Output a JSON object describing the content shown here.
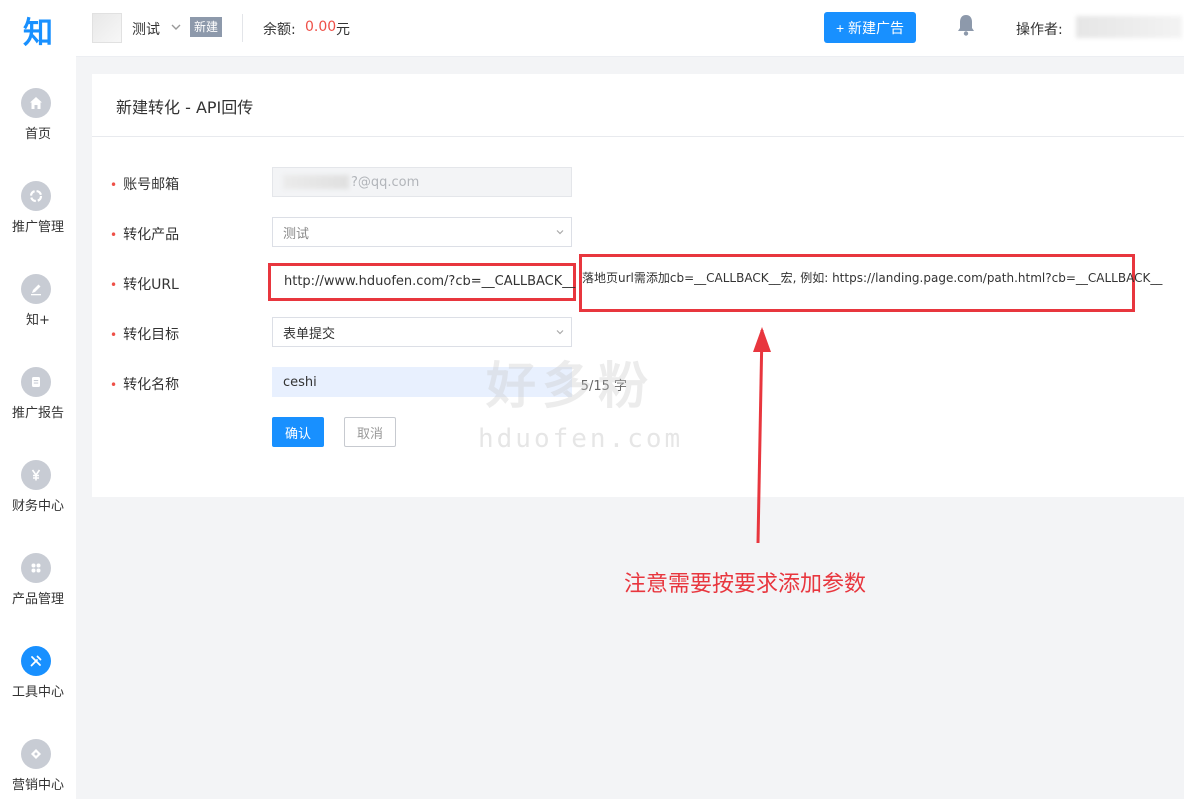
{
  "logo": "知",
  "sidebar": {
    "items": [
      {
        "label": "首页",
        "icon": "home-icon"
      },
      {
        "label": "推广管理",
        "icon": "promotion-icon"
      },
      {
        "label": "知+",
        "icon": "pen-icon"
      },
      {
        "label": "推广报告",
        "icon": "report-icon"
      },
      {
        "label": "财务中心",
        "icon": "yen-icon"
      },
      {
        "label": "产品管理",
        "icon": "grid-icon"
      },
      {
        "label": "工具中心",
        "icon": "tools-icon",
        "active": true
      },
      {
        "label": "营销中心",
        "icon": "marketing-icon"
      }
    ]
  },
  "header": {
    "account_name": "测试",
    "new_tag": "新建",
    "balance_label": "余额:",
    "balance_value": "0.00",
    "balance_unit": "元",
    "new_ad_button": "+ 新建广告",
    "operator_label": "操作者:"
  },
  "form": {
    "title": "新建转化 - API回传",
    "fields": {
      "email": {
        "label": "账号邮箱",
        "value": "?@qq.com"
      },
      "product": {
        "label": "转化产品",
        "value": "测试"
      },
      "url": {
        "label": "转化URL",
        "value": "http://www.hduofen.com/?cb=__CALLBACK__",
        "hint": "落地页url需添加cb=__CALLBACK__宏, 例如: https://landing.page.com/path.html?cb=__CALLBACK__"
      },
      "goal": {
        "label": "转化目标",
        "value": "表单提交"
      },
      "name": {
        "label": "转化名称",
        "value": "ceshi",
        "count": "5/15 字"
      }
    },
    "confirm_button": "确认",
    "cancel_button": "取消"
  },
  "watermark": {
    "cn": "好多粉",
    "en": "hduofen.com"
  },
  "annotation": "注意需要按要求添加参数",
  "colors": {
    "accent": "#1890ff",
    "danger": "#e8363e",
    "amount": "#ee5048"
  }
}
